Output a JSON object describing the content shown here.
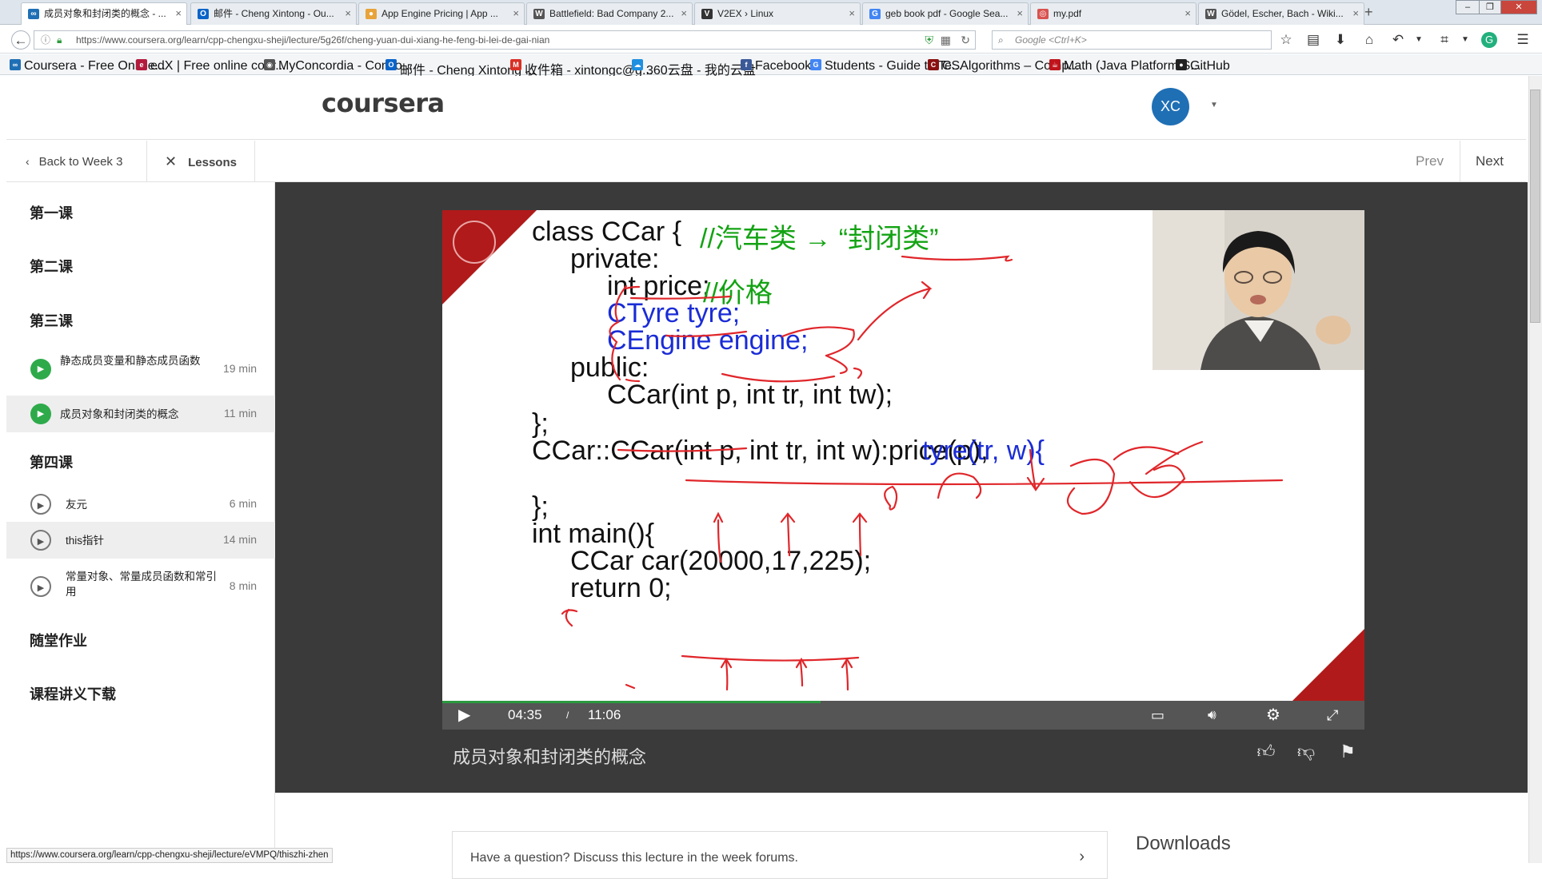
{
  "browser": {
    "tabs": [
      {
        "label": "成员对象和封闭类的概念 - ...",
        "icon": "coursera-icon",
        "color": "#1f6fb5",
        "glyph": "∞",
        "active": true
      },
      {
        "label": "邮件 - Cheng Xintong - Ou...",
        "icon": "outlook-icon",
        "color": "#0a64c8",
        "glyph": "O"
      },
      {
        "label": "App Engine Pricing | App ...",
        "icon": "google-cloud-icon",
        "color": "#e8a33a",
        "glyph": "●"
      },
      {
        "label": "Battlefield: Bad Company 2...",
        "icon": "wikipedia-icon",
        "color": "#555555",
        "glyph": "W"
      },
      {
        "label": "V2EX › Linux",
        "icon": "v2ex-icon",
        "color": "#333333",
        "glyph": "V"
      },
      {
        "label": "geb book pdf - Google Sea...",
        "icon": "google-icon",
        "color": "#4285f4",
        "glyph": "G"
      },
      {
        "label": "my.pdf",
        "icon": "pdf-icon",
        "color": "#d9534f",
        "glyph": "◎"
      },
      {
        "label": "Gödel, Escher, Bach - Wiki...",
        "icon": "wikipedia-icon",
        "color": "#555555",
        "glyph": "W"
      }
    ],
    "new_tab": "+",
    "url": "https://www.coursera.org/learn/cpp-chengxu-sheji/lecture/5g26f/cheng-yuan-dui-xiang-he-feng-bi-lei-de-gai-nian",
    "search_placeholder": "Google <Ctrl+K>",
    "bookmarks": [
      {
        "label": "Coursera - Free Online...",
        "icon": "coursera-icon",
        "color": "#1f6fb5",
        "glyph": "∞"
      },
      {
        "label": "edX | Free online cour...",
        "icon": "edx-icon",
        "color": "#b31b3d",
        "glyph": "e"
      },
      {
        "label": "MyConcordia - Conco...",
        "icon": "concordia-icon",
        "color": "#555555",
        "glyph": "◉"
      },
      {
        "label": "邮件 - Cheng Xintong ...",
        "icon": "outlook-icon",
        "color": "#0a64c8",
        "glyph": "O"
      },
      {
        "label": "收件箱 - xintongc@g...",
        "icon": "gmail-icon",
        "color": "#d93025",
        "glyph": "M"
      },
      {
        "label": "360云盘 - 我的云盘",
        "icon": "cloud-drive-icon",
        "color": "#1f8fe0",
        "glyph": "☁"
      },
      {
        "label": "Facebook",
        "icon": "facebook-icon",
        "color": "#3b5998",
        "glyph": "f"
      },
      {
        "label": "Students - Guide to Te...",
        "icon": "google-icon",
        "color": "#4285f4",
        "glyph": "G"
      },
      {
        "label": "CSAlgorithms – Comp...",
        "icon": "csa-icon",
        "color": "#8a1010",
        "glyph": "C"
      },
      {
        "label": "Math (Java Platform S...",
        "icon": "java-icon",
        "color": "#c0141c",
        "glyph": "☕"
      },
      {
        "label": "GitHub",
        "icon": "github-icon",
        "color": "#222222",
        "glyph": "●"
      }
    ]
  },
  "site": {
    "logo": "coursera",
    "avatar_initials": "XC",
    "back_label": "Back to Week 3",
    "lessons_label": "Lessons",
    "prev_label": "Prev",
    "next_label": "Next"
  },
  "sidebar": {
    "sections": [
      "第一课",
      "第二课",
      "第三课",
      "第四课",
      "随堂作业",
      "课程讲义下载"
    ],
    "lessons": [
      {
        "title": "静态成员变量和静态成员函数",
        "duration": "19 min",
        "status": "done"
      },
      {
        "title": "成员对象和封闭类的概念",
        "duration": "11 min",
        "status": "done",
        "current": true
      },
      {
        "title": "友元",
        "duration": "6 min",
        "status": "open"
      },
      {
        "title": "this指针",
        "duration": "14 min",
        "status": "open",
        "hover": true
      },
      {
        "title": "常量对象、常量成员函数和常引用",
        "duration": "8 min",
        "status": "open"
      }
    ]
  },
  "video": {
    "slide_lines": [
      {
        "text": "class CCar {",
        "kind": "black"
      },
      {
        "text": "//汽车类 → “封闭类”",
        "kind": "green"
      },
      {
        "text": "private:",
        "kind": "black"
      },
      {
        "text": "int price;",
        "kind": "black"
      },
      {
        "text": "//价格",
        "kind": "green"
      },
      {
        "text": "CTyre  tyre;",
        "kind": "blue"
      },
      {
        "text": "CEngine engine;",
        "kind": "blue"
      },
      {
        "text": "public:",
        "kind": "black"
      },
      {
        "text": "CCar(int p, int tr, int tw);",
        "kind": "black"
      },
      {
        "text": "};",
        "kind": "black"
      },
      {
        "text": "CCar::CCar(int p, int tr, int w):price(p), ",
        "kind": "black"
      },
      {
        "text": "tyre(tr, w){",
        "kind": "blue"
      },
      {
        "text": "};",
        "kind": "black"
      },
      {
        "text": "int main(){",
        "kind": "black"
      },
      {
        "text": "CCar car(20000,17,225);",
        "kind": "black"
      },
      {
        "text": "return 0;",
        "kind": "black"
      }
    ],
    "current_time": "04:35",
    "separator": "/",
    "total_time": "11:06",
    "progress": 0.41,
    "title": "成员对象和封闭类的概念",
    "colors": {
      "accent": "#2a9a40",
      "slide_corner": "#b01a1a",
      "code_blue": "#1a2cd6",
      "code_green": "#13a313",
      "annotation": "#e0262a"
    }
  },
  "page": {
    "question_prompt": "Have a question? Discuss this lecture in the week forums.",
    "downloads_heading": "Downloads",
    "status_url": "https://www.coursera.org/learn/cpp-chengxu-sheji/lecture/eVMPQ/thiszhi-zhen"
  }
}
